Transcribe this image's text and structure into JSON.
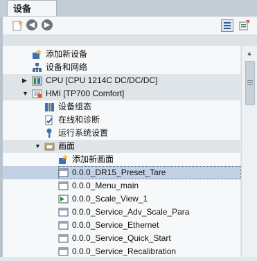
{
  "panel": {
    "tab_label": "设备"
  },
  "toolbar": {
    "add_icon": "add-page-icon",
    "back_icon": "arrow-left-icon",
    "forward_icon": "arrow-right-icon",
    "view_icon": "list-view-icon",
    "props_icon": "properties-icon"
  },
  "tree": {
    "add_device": "添加新设备",
    "devices_networks": "设备和网络",
    "cpu": "CPU [CPU 1214C DC/DC/DC]",
    "hmi": "HMI [TP700 Comfort]",
    "device_config": "设备组态",
    "online_diag": "在线和诊断",
    "runtime_settings": "运行系统设置",
    "screens": "画面",
    "add_screen": "添加新画面",
    "items": [
      "0.0.0_DR15_Preset_Tare",
      "0.0.0_Menu_main",
      "0.0.0_Scale_View_1",
      "0.0.0_Service_Adv_Scale_Para",
      "0.0.0_Service_Ethernet",
      "0.0.0_Service_Quick_Start",
      "0.0.0_Service_Recalibration"
    ]
  },
  "colors": {
    "selection": "#c3d1e4",
    "group_row": "#dfe4e8",
    "folder": "#e9c46a"
  }
}
